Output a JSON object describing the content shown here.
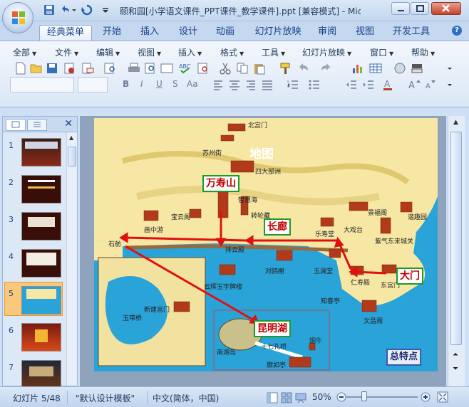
{
  "window": {
    "title": "颐和园[小学语文课件_PPT课件_教学课件].ppt [兼容模式] - Micro..."
  },
  "tabs": [
    "经典菜单",
    "开始",
    "插入",
    "设计",
    "动画",
    "幻灯片放映",
    "审阅",
    "视图",
    "开发工具"
  ],
  "menus": [
    "全部",
    "文件",
    "编辑",
    "视图",
    "插入",
    "格式",
    "工具",
    "幻灯片放映",
    "窗口",
    "帮助"
  ],
  "format_buttons": [
    "B",
    "I",
    "U",
    "S",
    "Aa"
  ],
  "slides_panel": {
    "numbers": [
      "1",
      "2",
      "3",
      "4",
      "5",
      "6",
      "7"
    ],
    "selected": "5"
  },
  "map": {
    "labels": {
      "beigongmen": "北宫门",
      "suzhoujie": "苏州街",
      "ditu": "地图",
      "sidabuzhou": "四大部洲",
      "zhihuihai": "智慧海",
      "zhuanlunzang": "转轮藏",
      "baoyunge": "宝云阁",
      "huazhongyou": "画中游",
      "shifang": "石舫",
      "paiyundian": "排云殿",
      "yunhui": "云辉玉宇牌楼",
      "duiouxie": "对鸥榭",
      "leshoutang": "乐寿堂",
      "yulantang": "玉澜堂",
      "renshoudian": "仁寿殿",
      "dadaxi": "大戏台",
      "jingfuge": "景福阁",
      "xiequyuan": "谐趣园",
      "ziqi": "紫气东来城关",
      "dongongmen": "东宫门",
      "zhichunting": "知春亭",
      "wenchangge": "文昌阁",
      "xinjiangongmen": "新建宫门",
      "yudaiqiao": "玉带桥",
      "nanhudao": "南湖岛",
      "shiqikongqiao": "十七孔桥",
      "tongniu": "铜牛",
      "kuoruting": "廓如亭"
    },
    "boxes": {
      "wanshoushan": "万寿山",
      "changlang": "长廊",
      "damen": "大门",
      "kunminghu": "昆明湖",
      "zongtedian": "总特点"
    }
  },
  "status": {
    "slide": "幻灯片 5/48",
    "template": "\"默认设计模板\"",
    "language": "中文(简体，中国)",
    "zoom": "50%"
  },
  "colors": {
    "path_arrow": "#e01010",
    "label_border": "#1a9c2a",
    "label_text": "#c00000",
    "water": "#2aa3d8",
    "land": "#f6e7a4"
  }
}
